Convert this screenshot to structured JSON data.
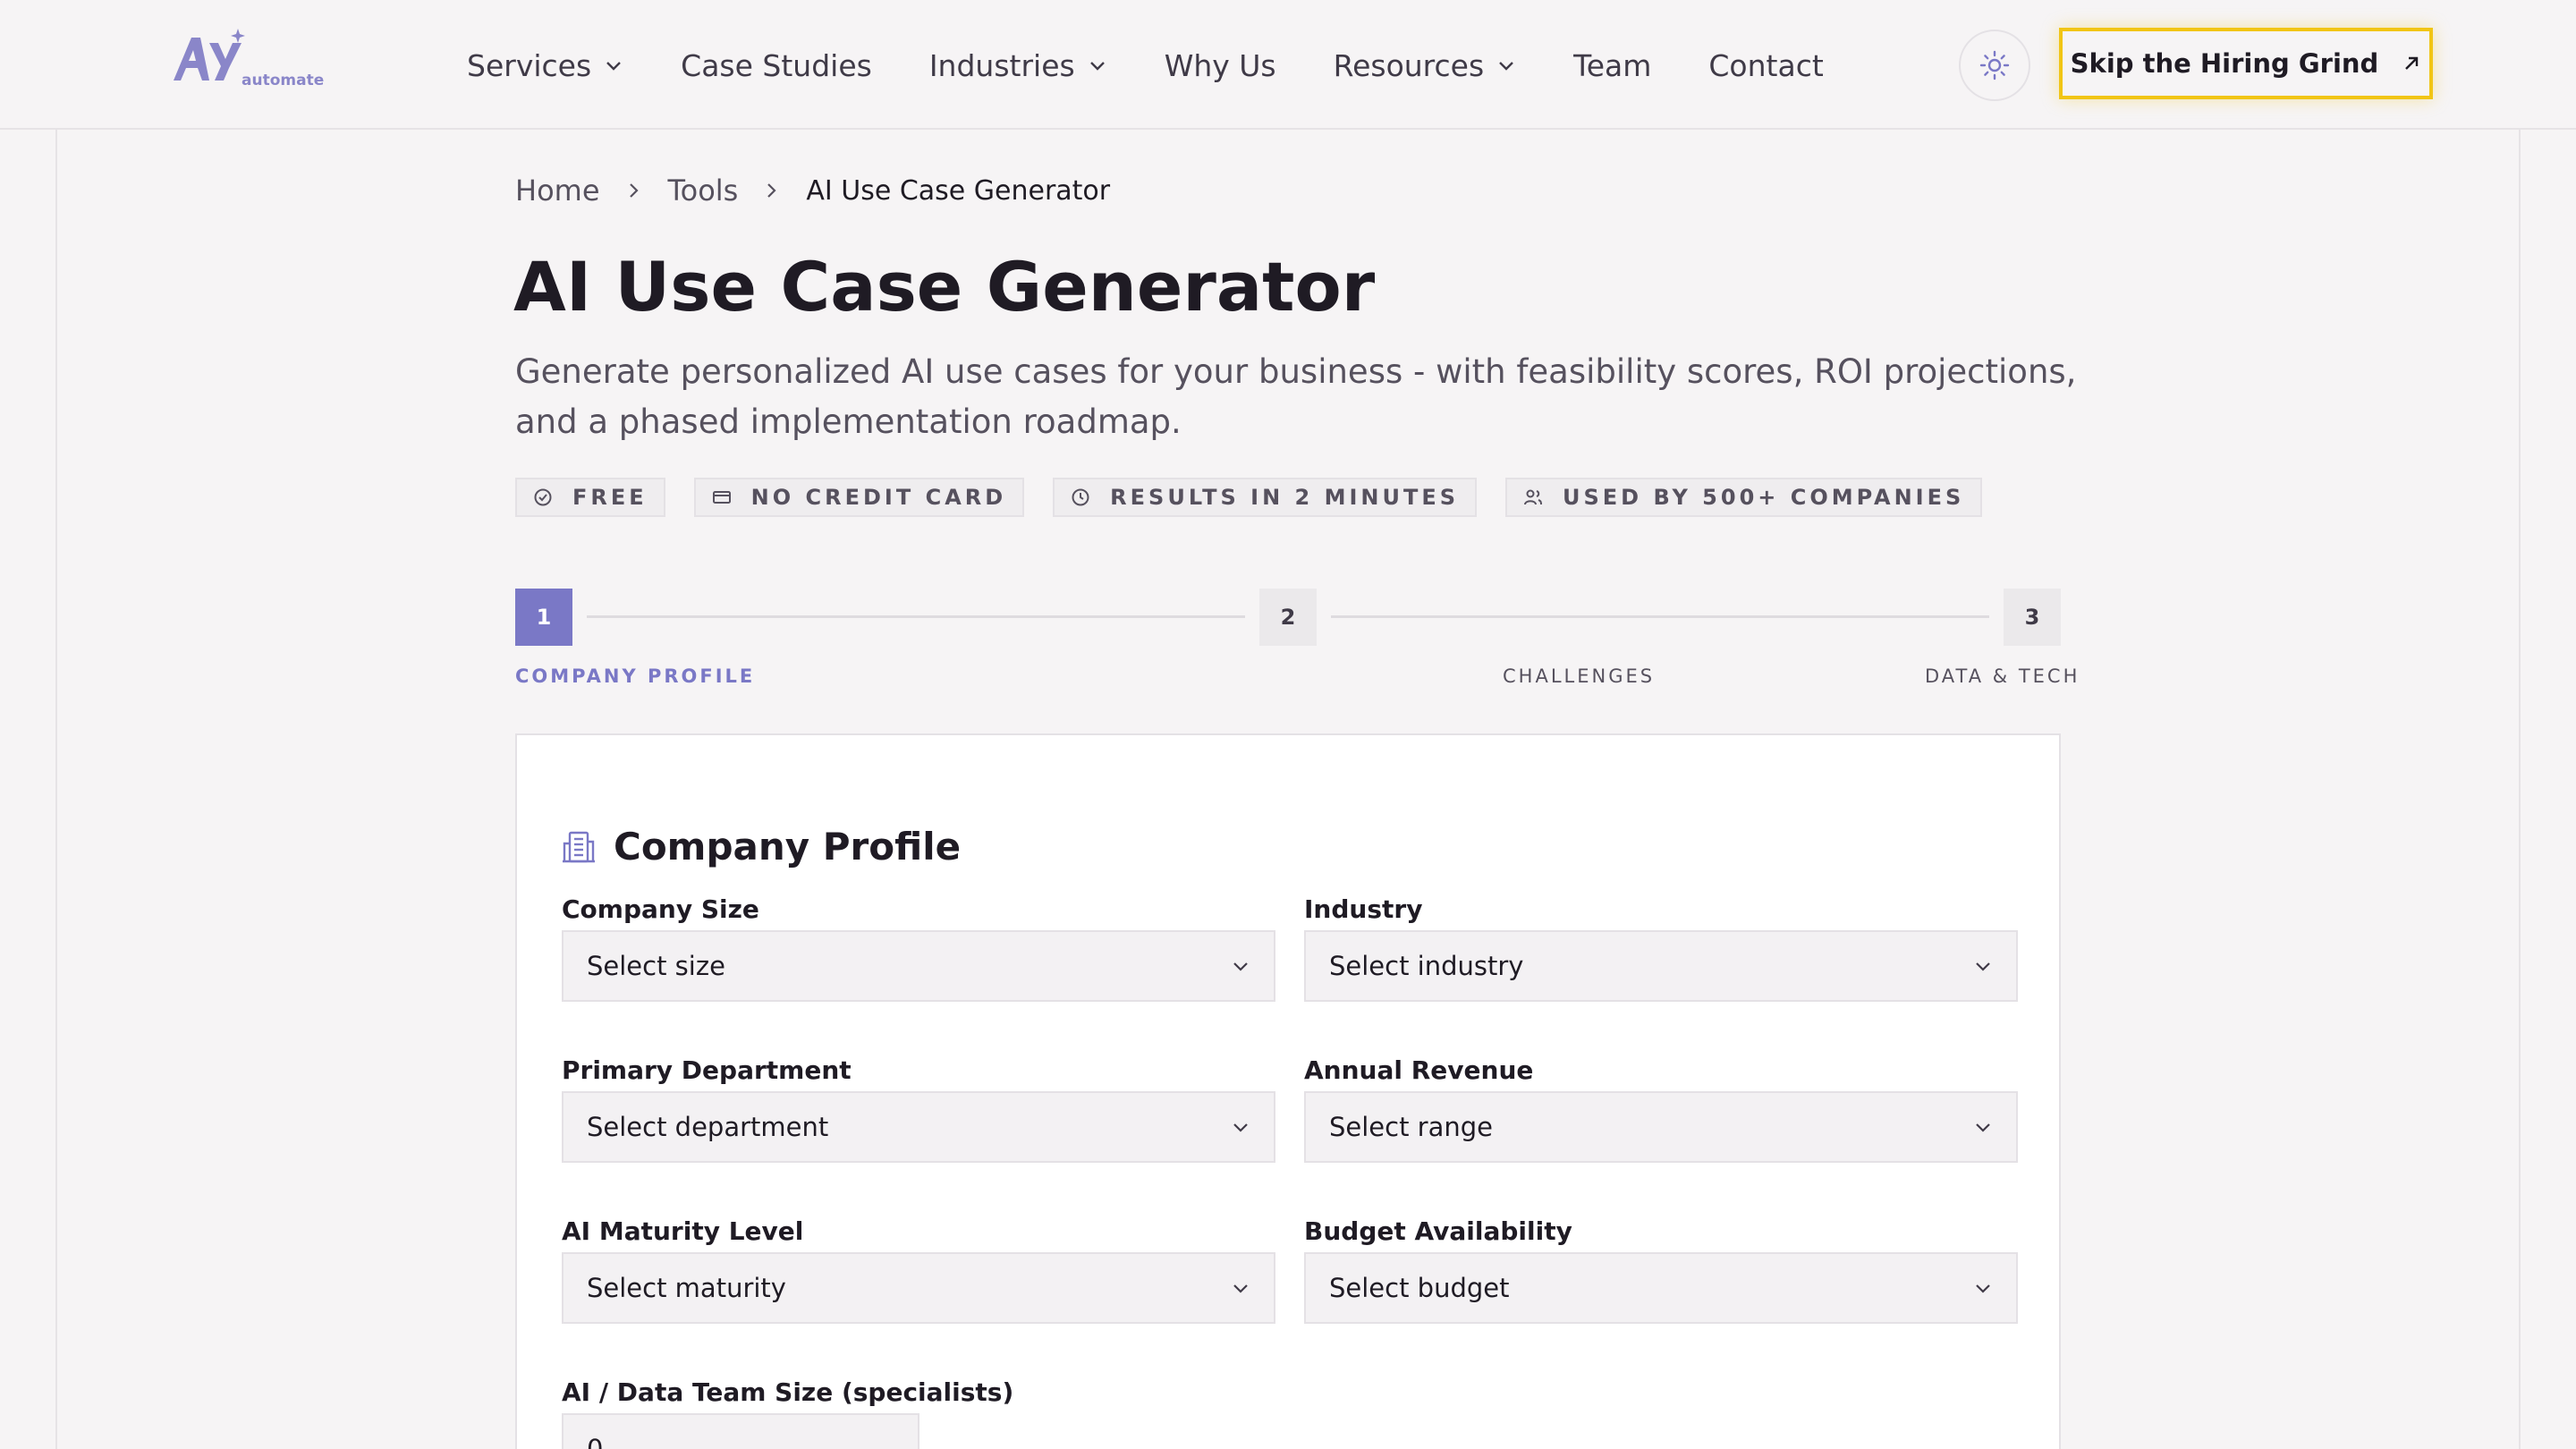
{
  "brand": {
    "logo_word": "automate",
    "accent": "#7a78c6",
    "cta_border": "#f1c515"
  },
  "nav": {
    "items": [
      {
        "label": "Services",
        "has_dropdown": true
      },
      {
        "label": "Case Studies",
        "has_dropdown": false
      },
      {
        "label": "Industries",
        "has_dropdown": true
      },
      {
        "label": "Why Us",
        "has_dropdown": false
      },
      {
        "label": "Resources",
        "has_dropdown": true
      },
      {
        "label": "Team",
        "has_dropdown": false
      },
      {
        "label": "Contact",
        "has_dropdown": false
      }
    ],
    "theme_icon": "sun-icon",
    "cta_label": "Skip the Hiring Grind"
  },
  "breadcrumb": {
    "home": "Home",
    "tools": "Tools",
    "current": "AI Use Case Generator"
  },
  "hero": {
    "title": "AI Use Case Generator",
    "subtitle": "Generate personalized AI use cases for your business - with feasibility scores, ROI projections, and a phased implementation roadmap.",
    "badges": [
      {
        "icon": "check-circle-icon",
        "label": "FREE"
      },
      {
        "icon": "credit-card-icon",
        "label": "NO CREDIT CARD"
      },
      {
        "icon": "clock-icon",
        "label": "RESULTS IN 2 MINUTES"
      },
      {
        "icon": "users-icon",
        "label": "USED BY 500+ COMPANIES"
      }
    ]
  },
  "stepper": {
    "active_step": 1,
    "steps": [
      {
        "number": "1",
        "label": "COMPANY PROFILE"
      },
      {
        "number": "2",
        "label": "CHALLENGES"
      },
      {
        "number": "3",
        "label": "DATA & TECH"
      }
    ]
  },
  "form": {
    "section_title": "Company Profile",
    "section_icon": "building-icon",
    "fields": {
      "company_size": {
        "label": "Company Size",
        "value": "Select size"
      },
      "industry": {
        "label": "Industry",
        "value": "Select industry"
      },
      "primary_department": {
        "label": "Primary Department",
        "value": "Select department"
      },
      "annual_revenue": {
        "label": "Annual Revenue",
        "value": "Select range"
      },
      "ai_maturity": {
        "label": "AI Maturity Level",
        "value": "Select maturity"
      },
      "budget": {
        "label": "Budget Availability",
        "value": "Select budget"
      },
      "team_size": {
        "label": "AI / Data Team Size (specialists)",
        "value": "0"
      }
    }
  }
}
